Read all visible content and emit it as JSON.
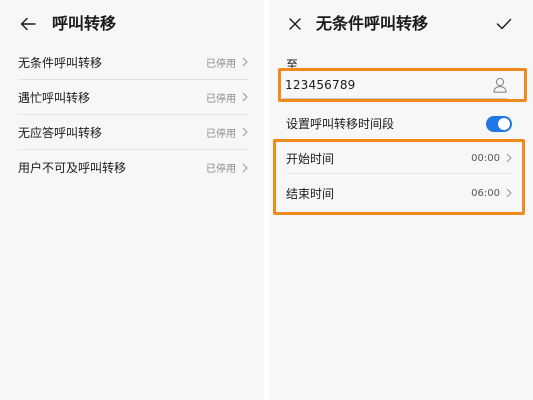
{
  "left_panel": {
    "title": "呼叫转移",
    "items": [
      {
        "label": "无条件呼叫转移",
        "status": "已停用"
      },
      {
        "label": "遇忙呼叫转移",
        "status": "已停用"
      },
      {
        "label": "无应答呼叫转移",
        "status": "已停用"
      },
      {
        "label": "用户不可及呼叫转移",
        "status": "已停用"
      }
    ]
  },
  "right_panel": {
    "title": "无条件呼叫转移",
    "to_label": "至",
    "phone_value": "123456789",
    "schedule_label": "设置呼叫转移时间段",
    "schedule_enabled": true,
    "start_time_label": "开始时间",
    "start_time_value": "00:00",
    "end_time_label": "结束时间",
    "end_time_value": "06:00"
  },
  "colors": {
    "highlight": "#f08a1c",
    "toggle_on": "#2176e8",
    "panel_bg": "#f7f7f7"
  },
  "icons": [
    "back-arrow-icon",
    "close-icon",
    "confirm-check-icon",
    "contact-icon",
    "chevron-right-icon"
  ]
}
